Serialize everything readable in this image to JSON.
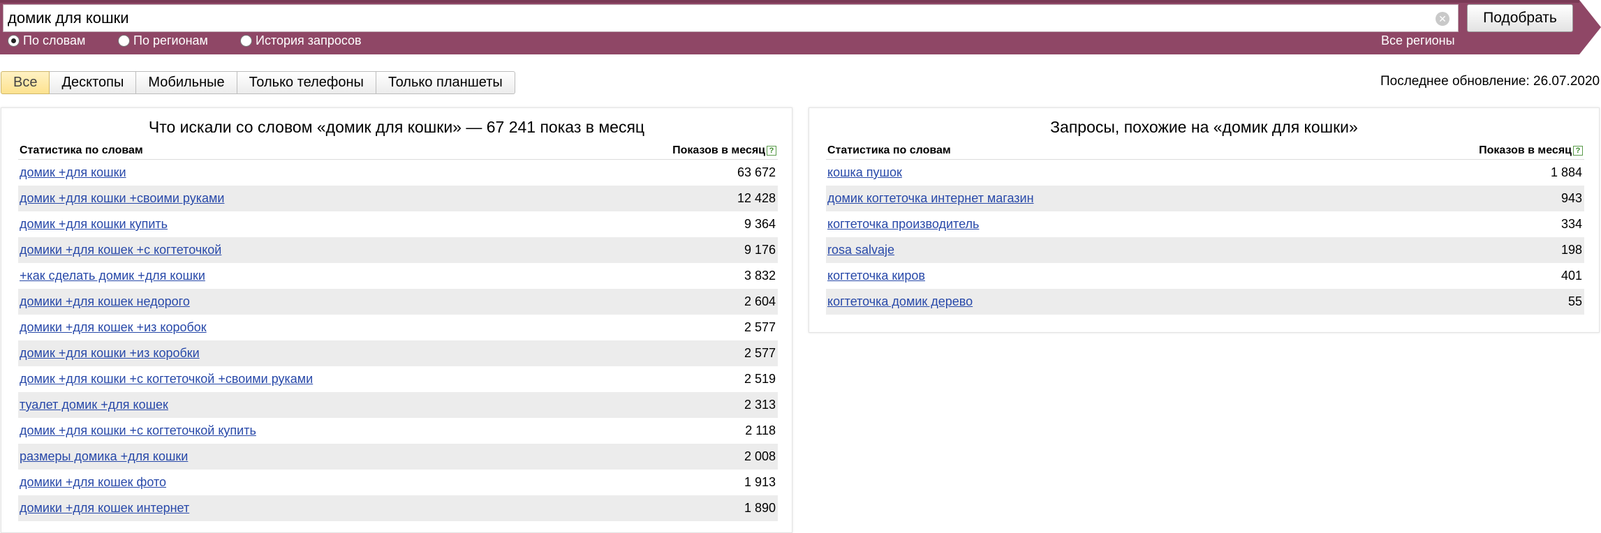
{
  "search": {
    "query": "домик для кошки",
    "button_label": "Подобрать",
    "modes": [
      {
        "label": "По словам",
        "selected": true
      },
      {
        "label": "По регионам",
        "selected": false
      },
      {
        "label": "История запросов",
        "selected": false
      }
    ],
    "regions_link": "Все регионы"
  },
  "device_tabs": [
    {
      "label": "Все",
      "active": true
    },
    {
      "label": "Десктопы",
      "active": false
    },
    {
      "label": "Мобильные",
      "active": false
    },
    {
      "label": "Только телефоны",
      "active": false
    },
    {
      "label": "Только планшеты",
      "active": false
    }
  ],
  "last_update": "Последнее обновление: 26.07.2020",
  "left_panel": {
    "title": "Что искали со словом «домик для кошки» — 67 241 показ в месяц",
    "col_phrase": "Статистика по словам",
    "col_count": "Показов в месяц",
    "help_glyph": "?",
    "rows": [
      {
        "phrase": "домик +для кошки",
        "count": "63 672"
      },
      {
        "phrase": "домик +для кошки +своими руками",
        "count": "12 428"
      },
      {
        "phrase": "домик +для кошки купить",
        "count": "9 364"
      },
      {
        "phrase": "домики +для кошек +с когтеточкой",
        "count": "9 176"
      },
      {
        "phrase": "+как сделать домик +для кошки",
        "count": "3 832"
      },
      {
        "phrase": "домики +для кошек недорого",
        "count": "2 604"
      },
      {
        "phrase": "домики +для кошек +из коробок",
        "count": "2 577"
      },
      {
        "phrase": "домик +для кошки +из коробки",
        "count": "2 577"
      },
      {
        "phrase": "домик +для кошки +с когтеточкой +своими руками",
        "count": "2 519"
      },
      {
        "phrase": "туалет домик +для кошек",
        "count": "2 313"
      },
      {
        "phrase": "домик +для кошки +с когтеточкой купить",
        "count": "2 118"
      },
      {
        "phrase": "размеры домика +для кошки",
        "count": "2 008"
      },
      {
        "phrase": "домики +для кошек фото",
        "count": "1 913"
      },
      {
        "phrase": "домики +для кошек интернет",
        "count": "1 890"
      }
    ]
  },
  "right_panel": {
    "title": "Запросы, похожие на «домик для кошки»",
    "col_phrase": "Статистика по словам",
    "col_count": "Показов в месяц",
    "help_glyph": "?",
    "rows": [
      {
        "phrase": "кошка пушок",
        "count": "1 884"
      },
      {
        "phrase": "домик когтеточка интернет магазин",
        "count": "943"
      },
      {
        "phrase": "когтеточка производитель",
        "count": "334"
      },
      {
        "phrase": "rosa salvaje",
        "count": "198"
      },
      {
        "phrase": "когтеточка киров",
        "count": "401"
      },
      {
        "phrase": "когтеточка домик дерево",
        "count": "55"
      }
    ]
  },
  "colors": {
    "band": "#8f4766",
    "link": "#2849a9",
    "active_tab": "#fde28f",
    "row_alt": "#ececec"
  }
}
